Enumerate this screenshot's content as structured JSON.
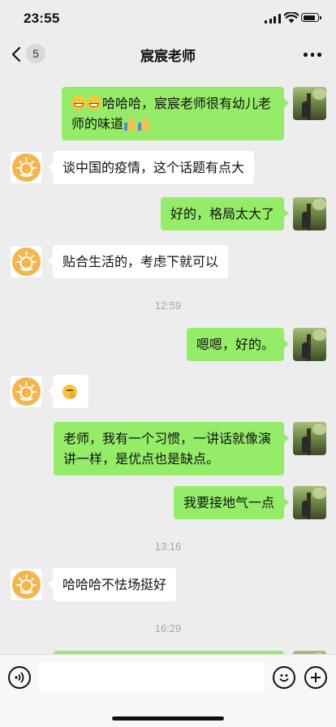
{
  "status_bar": {
    "time": "23:55"
  },
  "nav": {
    "back_count": "5",
    "title": "宸宸老师"
  },
  "messages": [
    {
      "from": "self",
      "emoji_prefix": [
        "grinning-face-emoji",
        "grinning-face-emoji"
      ],
      "text": "哈哈哈，宸宸老师很有幼儿老师的味道",
      "emoji_suffix": [
        "thumbs-up-emoji",
        "thumbs-up-emoji"
      ]
    },
    {
      "from": "other",
      "text": "谈中国的疫情，这个话题有点大"
    },
    {
      "from": "self",
      "text": "好的，格局太大了"
    },
    {
      "from": "other",
      "text": "贴合生活的，考虑下就可以"
    },
    {
      "type": "timestamp",
      "text": "12:59"
    },
    {
      "from": "self",
      "text": "嗯嗯，好的。"
    },
    {
      "from": "other",
      "emoji": "thinking-face-emoji"
    },
    {
      "from": "self",
      "text": "老师，我有一个习惯，一讲话就像演讲一样，是优点也是缺点。"
    },
    {
      "from": "self",
      "text": "我要接地气一点"
    },
    {
      "type": "timestamp",
      "text": "13:16"
    },
    {
      "from": "other",
      "text": "哈哈哈不怯场挺好"
    },
    {
      "type": "timestamp",
      "text": "16:29"
    }
  ],
  "input": {
    "value": ""
  }
}
